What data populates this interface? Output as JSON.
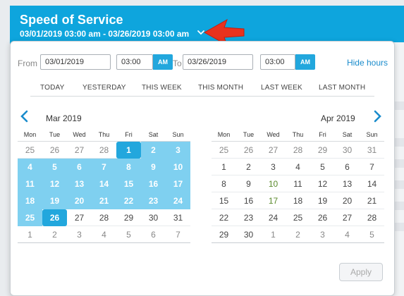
{
  "header": {
    "title": "Speed of Service",
    "range": "03/01/2019 03:00 am - 03/26/2019 03:00 am"
  },
  "picker": {
    "from_label": "From",
    "to_label": "To",
    "from_date": "03/01/2019",
    "from_time": "03:00",
    "from_ampm": "AM",
    "to_date": "03/26/2019",
    "to_time": "03:00",
    "to_ampm": "AM",
    "hide_hours": "Hide hours"
  },
  "presets": [
    "TODAY",
    "YESTERDAY",
    "THIS WEEK",
    "THIS MONTH",
    "LAST WEEK",
    "LAST MONTH"
  ],
  "weekdays": [
    "Mon",
    "Tue",
    "Wed",
    "Thu",
    "Fri",
    "Sat",
    "Sun"
  ],
  "left_month": {
    "title": "Mar 2019",
    "weeks": [
      [
        {
          "d": "25",
          "s": "mut"
        },
        {
          "d": "26",
          "s": "mut"
        },
        {
          "d": "27",
          "s": "mut"
        },
        {
          "d": "28",
          "s": "mut"
        },
        {
          "d": "1",
          "s": "sel"
        },
        {
          "d": "2",
          "s": "rng"
        },
        {
          "d": "3",
          "s": "rng"
        }
      ],
      [
        {
          "d": "4",
          "s": "rng"
        },
        {
          "d": "5",
          "s": "rng"
        },
        {
          "d": "6",
          "s": "rng"
        },
        {
          "d": "7",
          "s": "rng"
        },
        {
          "d": "8",
          "s": "rng"
        },
        {
          "d": "9",
          "s": "rng"
        },
        {
          "d": "10",
          "s": "rng"
        }
      ],
      [
        {
          "d": "11",
          "s": "rng"
        },
        {
          "d": "12",
          "s": "rng"
        },
        {
          "d": "13",
          "s": "rng"
        },
        {
          "d": "14",
          "s": "rng"
        },
        {
          "d": "15",
          "s": "rng"
        },
        {
          "d": "16",
          "s": "rng"
        },
        {
          "d": "17",
          "s": "rng"
        }
      ],
      [
        {
          "d": "18",
          "s": "rng"
        },
        {
          "d": "19",
          "s": "rng"
        },
        {
          "d": "20",
          "s": "rng"
        },
        {
          "d": "21",
          "s": "rng"
        },
        {
          "d": "22",
          "s": "rng"
        },
        {
          "d": "23",
          "s": "rng"
        },
        {
          "d": "24",
          "s": "rng"
        }
      ],
      [
        {
          "d": "25",
          "s": "rng"
        },
        {
          "d": "26",
          "s": "sel"
        },
        {
          "d": "27",
          "s": ""
        },
        {
          "d": "28",
          "s": ""
        },
        {
          "d": "29",
          "s": ""
        },
        {
          "d": "30",
          "s": ""
        },
        {
          "d": "31",
          "s": ""
        }
      ],
      [
        {
          "d": "1",
          "s": "mut"
        },
        {
          "d": "2",
          "s": "mut"
        },
        {
          "d": "3",
          "s": "mut"
        },
        {
          "d": "4",
          "s": "mut"
        },
        {
          "d": "5",
          "s": "mut"
        },
        {
          "d": "6",
          "s": "mut"
        },
        {
          "d": "7",
          "s": "mut"
        }
      ]
    ]
  },
  "right_month": {
    "title": "Apr 2019",
    "weeks": [
      [
        {
          "d": "25",
          "s": "mut"
        },
        {
          "d": "26",
          "s": "mut"
        },
        {
          "d": "27",
          "s": "mut"
        },
        {
          "d": "28",
          "s": "mut"
        },
        {
          "d": "29",
          "s": "mut"
        },
        {
          "d": "30",
          "s": "mut"
        },
        {
          "d": "31",
          "s": "mut"
        }
      ],
      [
        {
          "d": "1",
          "s": ""
        },
        {
          "d": "2",
          "s": ""
        },
        {
          "d": "3",
          "s": ""
        },
        {
          "d": "4",
          "s": ""
        },
        {
          "d": "5",
          "s": ""
        },
        {
          "d": "6",
          "s": ""
        },
        {
          "d": "7",
          "s": ""
        }
      ],
      [
        {
          "d": "8",
          "s": ""
        },
        {
          "d": "9",
          "s": ""
        },
        {
          "d": "10",
          "s": "green"
        },
        {
          "d": "11",
          "s": ""
        },
        {
          "d": "12",
          "s": ""
        },
        {
          "d": "13",
          "s": ""
        },
        {
          "d": "14",
          "s": ""
        }
      ],
      [
        {
          "d": "15",
          "s": ""
        },
        {
          "d": "16",
          "s": ""
        },
        {
          "d": "17",
          "s": "green"
        },
        {
          "d": "18",
          "s": ""
        },
        {
          "d": "19",
          "s": ""
        },
        {
          "d": "20",
          "s": ""
        },
        {
          "d": "21",
          "s": ""
        }
      ],
      [
        {
          "d": "22",
          "s": ""
        },
        {
          "d": "23",
          "s": ""
        },
        {
          "d": "24",
          "s": ""
        },
        {
          "d": "25",
          "s": ""
        },
        {
          "d": "26",
          "s": ""
        },
        {
          "d": "27",
          "s": ""
        },
        {
          "d": "28",
          "s": ""
        }
      ],
      [
        {
          "d": "29",
          "s": ""
        },
        {
          "d": "30",
          "s": ""
        },
        {
          "d": "1",
          "s": "mut"
        },
        {
          "d": "2",
          "s": "mut"
        },
        {
          "d": "3",
          "s": "mut"
        },
        {
          "d": "4",
          "s": "mut"
        },
        {
          "d": "5",
          "s": "mut"
        }
      ]
    ]
  },
  "nav": {
    "prev_icon": "chevron-left-icon",
    "next_icon": "chevron-right-icon"
  },
  "apply_label": "Apply",
  "colors": {
    "header_bg": "#0ea5dd",
    "accent": "#22a7dd",
    "range_fill": "#7fd0f0",
    "arrow": "#e8321e"
  }
}
